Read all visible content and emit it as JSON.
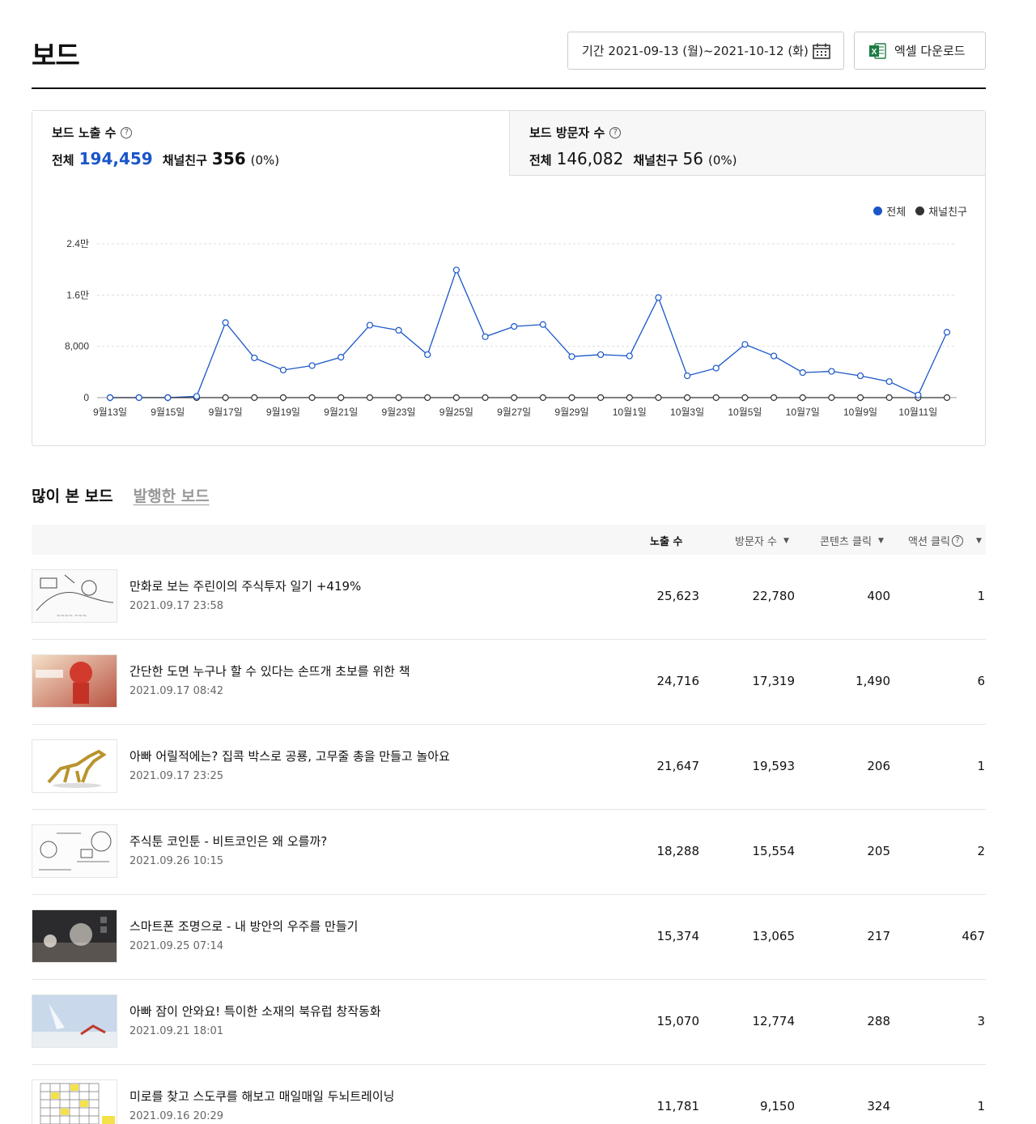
{
  "header": {
    "title": "보드",
    "period_label": "기간 2021-09-13 (월)~2021-10-12 (화)",
    "excel_label": "엑셀 다운로드"
  },
  "stats": {
    "exposure": {
      "title": "보드 노출 수",
      "all_label": "전체",
      "all_value": "194,459",
      "friend_label": "채널친구",
      "friend_value": "356",
      "friend_pct": "(0%)"
    },
    "visitors": {
      "title": "보드 방문자 수",
      "all_label": "전체",
      "all_value": "146,082",
      "friend_label": "채널친구",
      "friend_value": "56",
      "friend_pct": "(0%)"
    }
  },
  "chart_data": {
    "type": "line",
    "x": [
      "9월13일",
      "9월14일",
      "9월15일",
      "9월16일",
      "9월17일",
      "9월18일",
      "9월19일",
      "9월20일",
      "9월21일",
      "9월22일",
      "9월23일",
      "9월24일",
      "9월25일",
      "9월26일",
      "9월27일",
      "9월28일",
      "9월29일",
      "9월30일",
      "10월1일",
      "10월2일",
      "10월3일",
      "10월4일",
      "10월5일",
      "10월6일",
      "10월7일",
      "10월8일",
      "10월9일",
      "10월10일",
      "10월11일",
      "10월12일"
    ],
    "tick_labels": [
      "9월13일",
      "9월15일",
      "9월17일",
      "9월19일",
      "9월21일",
      "9월23일",
      "9월25일",
      "9월27일",
      "9월29일",
      "10월1일",
      "10월3일",
      "10월5일",
      "10월7일",
      "10월9일",
      "10월11일"
    ],
    "y_ticks": [
      "0",
      "8,000",
      "1.6만",
      "2.4만"
    ],
    "y_tick_values": [
      0,
      8000,
      16000,
      24000
    ],
    "ylim": [
      0,
      24000
    ],
    "legend_placement": "top-right",
    "grid": true,
    "series": [
      {
        "name": "전체",
        "color": "#1a56c8",
        "values": [
          0,
          0,
          0,
          200,
          11700,
          6200,
          4300,
          5000,
          6300,
          11300,
          10500,
          6700,
          19900,
          9500,
          11100,
          11400,
          6400,
          6700,
          6500,
          15600,
          3400,
          4600,
          8300,
          6500,
          3900,
          4100,
          3400,
          2500,
          400,
          10200
        ]
      },
      {
        "name": "채널친구",
        "color": "#333333",
        "values": [
          0,
          0,
          0,
          0,
          0,
          0,
          0,
          0,
          0,
          0,
          0,
          0,
          0,
          0,
          0,
          0,
          0,
          0,
          0,
          0,
          0,
          0,
          0,
          0,
          0,
          0,
          0,
          0,
          0,
          0
        ]
      }
    ]
  },
  "list": {
    "tabs": [
      "많이 본 보드",
      "발행한 보드"
    ],
    "columns": {
      "exposure": "노출 수",
      "visitors": "방문자 수",
      "content_click": "콘텐츠 클릭",
      "action_click": "액션 클릭"
    },
    "rows": [
      {
        "title": "만화로 보는 주린이의 주식투자 일기 +419%",
        "date": "2021.09.17 23:58",
        "exposure": "25,623",
        "visitors": "22,780",
        "content_click": "400",
        "action_click": "1"
      },
      {
        "title": "간단한 도면 누구나 할 수 있다는 손뜨개 초보를 위한 책",
        "date": "2021.09.17 08:42",
        "exposure": "24,716",
        "visitors": "17,319",
        "content_click": "1,490",
        "action_click": "6"
      },
      {
        "title": "아빠 어릴적에는? 집콕 박스로 공룡, 고무줄 총을 만들고 놀아요",
        "date": "2021.09.17 23:25",
        "exposure": "21,647",
        "visitors": "19,593",
        "content_click": "206",
        "action_click": "1"
      },
      {
        "title": "주식툰 코인툰 - 비트코인은 왜 오를까?",
        "date": "2021.09.26 10:15",
        "exposure": "18,288",
        "visitors": "15,554",
        "content_click": "205",
        "action_click": "2"
      },
      {
        "title": "스마트폰 조명으로 - 내 방안의 우주를 만들기",
        "date": "2021.09.25 07:14",
        "exposure": "15,374",
        "visitors": "13,065",
        "content_click": "217",
        "action_click": "467"
      },
      {
        "title": "아빠 잠이 안와요! 특이한 소재의 북유럽 창작동화",
        "date": "2021.09.21 18:01",
        "exposure": "15,070",
        "visitors": "12,774",
        "content_click": "288",
        "action_click": "3"
      },
      {
        "title": "미로를 찾고 스도쿠를 해보고 매일매일 두뇌트레이닝",
        "date": "2021.09.16 20:29",
        "exposure": "11,781",
        "visitors": "9,150",
        "content_click": "324",
        "action_click": "1"
      }
    ]
  }
}
